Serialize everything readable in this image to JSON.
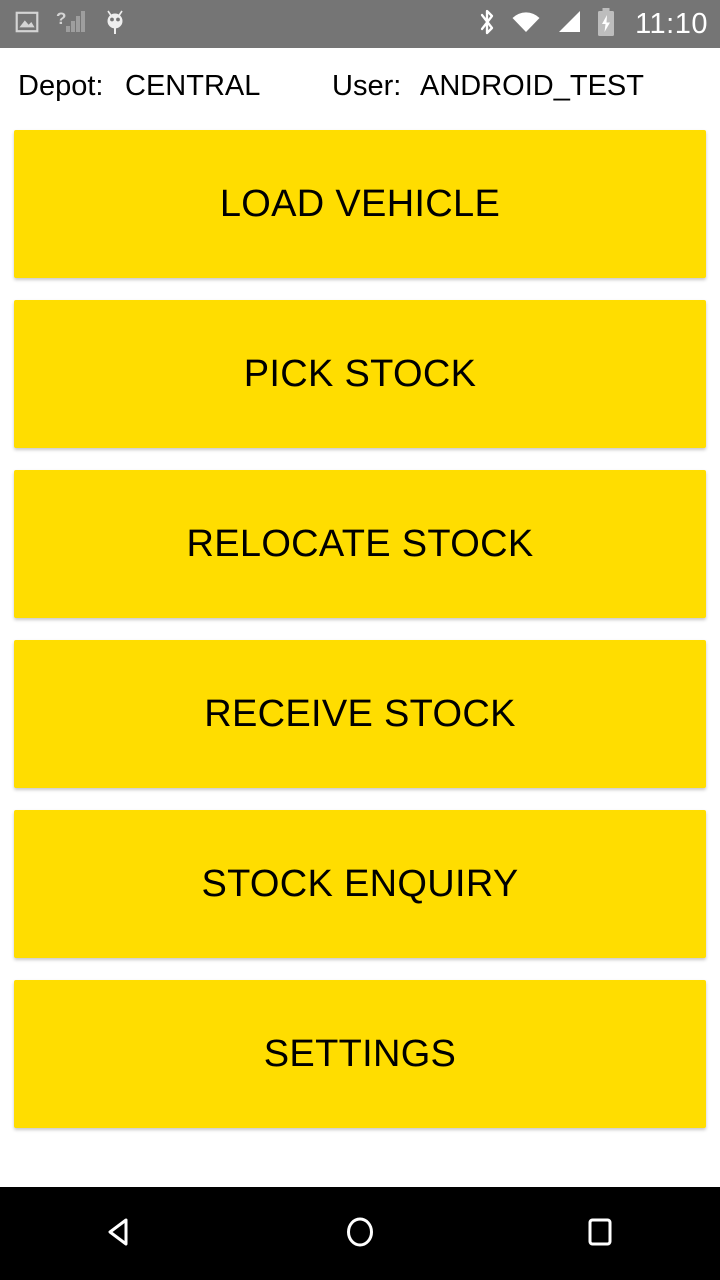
{
  "status_bar": {
    "background_color": "#757575",
    "time": "11:10",
    "left_icons": [
      {
        "name": "image-icon",
        "label": "Screenshot"
      },
      {
        "name": "no-sim-signal-icon",
        "label": "No SIM"
      },
      {
        "name": "android-debug-icon",
        "label": "USB debugging"
      }
    ],
    "right_icons": [
      {
        "name": "bluetooth-icon",
        "label": "Bluetooth"
      },
      {
        "name": "wifi-icon",
        "label": "Wi-Fi"
      },
      {
        "name": "cell-signal-icon",
        "label": "Mobile signal"
      },
      {
        "name": "battery-charging-icon",
        "label": "Battery charging"
      }
    ]
  },
  "header": {
    "depot_label": "Depot:",
    "depot_value": "CENTRAL",
    "user_label": "User:",
    "user_value": "ANDROID_TEST"
  },
  "menu": {
    "accent_color": "#FFDD00",
    "text_color": "#000000",
    "buttons": [
      {
        "id": "load-vehicle",
        "label": "LOAD VEHICLE"
      },
      {
        "id": "pick-stock",
        "label": "PICK STOCK"
      },
      {
        "id": "relocate-stock",
        "label": "RELOCATE STOCK"
      },
      {
        "id": "receive-stock",
        "label": "RECEIVE STOCK"
      },
      {
        "id": "stock-enquiry",
        "label": "STOCK ENQUIRY"
      },
      {
        "id": "settings",
        "label": "SETTINGS"
      }
    ]
  },
  "nav_bar": {
    "background_color": "#000000",
    "buttons": [
      {
        "name": "back-button",
        "icon": "triangle-left-icon",
        "label": "Back"
      },
      {
        "name": "home-button",
        "icon": "circle-icon",
        "label": "Home"
      },
      {
        "name": "recents-button",
        "icon": "square-icon",
        "label": "Recents"
      }
    ]
  }
}
